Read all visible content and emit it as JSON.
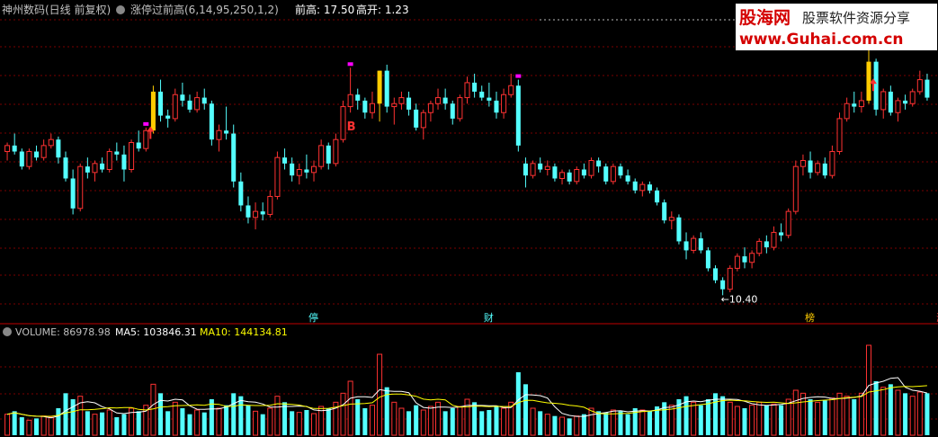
{
  "header": {
    "title": "神州数码(日线 前复权)",
    "indicator": "涨停过前高(6,14,95,250,1,2)",
    "prev_high_label": "前高: 17.50",
    "gap_label": "高开: 1.23"
  },
  "watermark": {
    "brand": "股海网",
    "slogan": "股票软件资源分享",
    "url": "www.Guhai.com.cn"
  },
  "annotations": {
    "buy": "B",
    "low": "←10.40",
    "tags": [
      "停",
      "财",
      "榜",
      "涨"
    ]
  },
  "volume_header": {
    "volume": "VOLUME: 86978.98",
    "ma5": "MA5: 103846.31",
    "ma10": "MA10: 144134.81"
  },
  "colors": {
    "up": "#ff3232",
    "down": "#54ffff",
    "limit_up": "#ffcc00",
    "marker": "#ff00ff",
    "ma5": "#ffffff",
    "ma10": "#ffff00",
    "grid": "#7a0000"
  },
  "chart_data": {
    "type": "candlestick",
    "low_value": 10.4,
    "prev_high": 17.5,
    "candles": [
      [
        15.2,
        15.5,
        14.9,
        15.4
      ],
      [
        15.4,
        15.8,
        15.1,
        15.2
      ],
      [
        15.2,
        15.3,
        14.6,
        14.7
      ],
      [
        14.7,
        15.3,
        14.6,
        15.2
      ],
      [
        15.2,
        15.4,
        14.9,
        15.0
      ],
      [
        15.0,
        15.6,
        14.9,
        15.4
      ],
      [
        15.4,
        15.8,
        15.3,
        15.6
      ],
      [
        15.6,
        15.7,
        14.8,
        15.0
      ],
      [
        15.0,
        15.2,
        14.2,
        14.3
      ],
      [
        14.3,
        14.6,
        13.1,
        13.3
      ],
      [
        13.3,
        14.8,
        13.2,
        14.7
      ],
      [
        14.7,
        15.0,
        14.3,
        14.5
      ],
      [
        14.5,
        14.9,
        14.2,
        14.8
      ],
      [
        14.8,
        15.0,
        14.5,
        14.6
      ],
      [
        14.6,
        15.3,
        14.5,
        15.2
      ],
      [
        15.2,
        15.5,
        14.9,
        15.1
      ],
      [
        15.1,
        15.4,
        14.2,
        14.6
      ],
      [
        14.6,
        15.6,
        14.5,
        15.5
      ],
      [
        15.5,
        15.9,
        15.2,
        15.3
      ],
      [
        15.3,
        16.0,
        15.2,
        15.9
      ],
      [
        15.9,
        17.4,
        15.8,
        17.2
      ],
      [
        17.2,
        17.6,
        16.2,
        16.4
      ],
      [
        16.4,
        16.6,
        16.0,
        16.3
      ],
      [
        16.3,
        17.3,
        16.2,
        17.1
      ],
      [
        17.1,
        17.5,
        16.7,
        16.9
      ],
      [
        16.9,
        17.1,
        16.5,
        16.6
      ],
      [
        16.6,
        17.2,
        16.5,
        17.0
      ],
      [
        17.0,
        17.3,
        16.6,
        16.8
      ],
      [
        16.8,
        16.9,
        15.4,
        15.6
      ],
      [
        15.6,
        16.1,
        15.2,
        15.9
      ],
      [
        15.9,
        16.7,
        15.6,
        15.8
      ],
      [
        15.8,
        16.1,
        14.0,
        14.2
      ],
      [
        14.2,
        14.5,
        13.2,
        13.4
      ],
      [
        13.4,
        13.7,
        12.8,
        13.0
      ],
      [
        13.0,
        13.5,
        12.6,
        13.2
      ],
      [
        13.2,
        13.5,
        12.9,
        13.1
      ],
      [
        13.1,
        13.9,
        13.0,
        13.7
      ],
      [
        13.7,
        15.2,
        13.6,
        15.0
      ],
      [
        15.0,
        15.3,
        14.6,
        14.8
      ],
      [
        14.8,
        15.0,
        14.2,
        14.4
      ],
      [
        14.4,
        14.8,
        14.1,
        14.6
      ],
      [
        14.6,
        15.1,
        14.3,
        14.5
      ],
      [
        14.5,
        14.9,
        14.2,
        14.7
      ],
      [
        14.7,
        15.6,
        14.6,
        15.4
      ],
      [
        15.4,
        15.5,
        14.6,
        14.8
      ],
      [
        14.8,
        15.8,
        14.7,
        15.6
      ],
      [
        15.6,
        16.9,
        15.5,
        16.7
      ],
      [
        16.7,
        18.0,
        16.5,
        17.1
      ],
      [
        17.1,
        17.3,
        16.6,
        16.9
      ],
      [
        16.9,
        17.0,
        16.3,
        16.5
      ],
      [
        16.5,
        17.2,
        16.3,
        16.8
      ],
      [
        16.8,
        17.9,
        16.2,
        17.9
      ],
      [
        17.9,
        18.1,
        16.5,
        16.7
      ],
      [
        16.7,
        17.0,
        16.1,
        16.8
      ],
      [
        16.8,
        17.2,
        16.6,
        17.0
      ],
      [
        17.0,
        17.2,
        16.4,
        16.6
      ],
      [
        16.6,
        16.8,
        15.9,
        16.0
      ],
      [
        16.0,
        16.6,
        15.6,
        16.5
      ],
      [
        16.5,
        16.9,
        16.2,
        16.8
      ],
      [
        16.8,
        17.3,
        16.6,
        17.0
      ],
      [
        17.0,
        17.3,
        16.6,
        16.8
      ],
      [
        16.8,
        16.9,
        16.1,
        16.3
      ],
      [
        16.3,
        17.1,
        16.2,
        17.0
      ],
      [
        17.0,
        17.7,
        16.8,
        17.5
      ],
      [
        17.5,
        17.8,
        17.0,
        17.2
      ],
      [
        17.2,
        17.4,
        16.9,
        17.0
      ],
      [
        17.0,
        17.5,
        16.7,
        16.9
      ],
      [
        16.9,
        17.2,
        16.3,
        16.5
      ],
      [
        16.5,
        17.3,
        16.3,
        17.1
      ],
      [
        17.1,
        17.8,
        17.0,
        17.4
      ],
      [
        17.4,
        17.6,
        15.2,
        15.4
      ],
      [
        14.8,
        15.0,
        14.0,
        14.4
      ],
      [
        14.4,
        14.9,
        14.3,
        14.8
      ],
      [
        14.8,
        15.0,
        14.5,
        14.6
      ],
      [
        14.6,
        14.9,
        14.4,
        14.7
      ],
      [
        14.7,
        14.8,
        14.2,
        14.3
      ],
      [
        14.3,
        14.6,
        14.1,
        14.5
      ],
      [
        14.5,
        14.6,
        14.1,
        14.2
      ],
      [
        14.2,
        14.7,
        14.1,
        14.6
      ],
      [
        14.6,
        14.8,
        14.3,
        14.4
      ],
      [
        14.4,
        15.0,
        14.3,
        14.9
      ],
      [
        14.9,
        15.0,
        14.5,
        14.7
      ],
      [
        14.7,
        14.8,
        14.1,
        14.2
      ],
      [
        14.2,
        14.8,
        14.1,
        14.7
      ],
      [
        14.7,
        14.8,
        14.3,
        14.4
      ],
      [
        14.4,
        14.6,
        14.1,
        14.2
      ],
      [
        14.2,
        14.3,
        13.8,
        13.9
      ],
      [
        13.9,
        14.2,
        13.7,
        14.1
      ],
      [
        14.1,
        14.2,
        13.8,
        13.9
      ],
      [
        13.9,
        14.0,
        13.4,
        13.5
      ],
      [
        13.5,
        13.6,
        12.8,
        12.9
      ],
      [
        12.9,
        13.2,
        12.6,
        13.0
      ],
      [
        13.0,
        13.1,
        12.1,
        12.2
      ],
      [
        12.2,
        12.5,
        11.6,
        11.9
      ],
      [
        11.9,
        12.4,
        11.8,
        12.3
      ],
      [
        12.3,
        12.5,
        11.8,
        11.9
      ],
      [
        11.9,
        12.0,
        11.2,
        11.3
      ],
      [
        11.3,
        11.4,
        10.8,
        10.9
      ],
      [
        10.9,
        11.0,
        10.4,
        10.6
      ],
      [
        10.6,
        11.4,
        10.5,
        11.3
      ],
      [
        11.3,
        11.8,
        11.2,
        11.7
      ],
      [
        11.7,
        12.0,
        11.3,
        11.5
      ],
      [
        11.5,
        11.9,
        11.3,
        11.8
      ],
      [
        11.8,
        12.3,
        11.7,
        12.2
      ],
      [
        12.2,
        12.4,
        11.8,
        12.0
      ],
      [
        12.0,
        12.7,
        11.9,
        12.5
      ],
      [
        12.5,
        12.8,
        12.2,
        12.4
      ],
      [
        12.4,
        13.3,
        12.3,
        13.2
      ],
      [
        13.2,
        14.9,
        13.1,
        14.7
      ],
      [
        14.7,
        15.1,
        14.4,
        14.9
      ],
      [
        14.9,
        15.2,
        14.3,
        14.5
      ],
      [
        14.5,
        14.9,
        14.4,
        14.8
      ],
      [
        14.8,
        15.0,
        14.3,
        14.4
      ],
      [
        14.4,
        15.4,
        14.3,
        15.2
      ],
      [
        15.2,
        16.5,
        15.1,
        16.3
      ],
      [
        16.3,
        17.0,
        16.2,
        16.8
      ],
      [
        16.8,
        17.2,
        16.5,
        16.7
      ],
      [
        16.7,
        17.2,
        16.5,
        16.9
      ],
      [
        16.9,
        19.2,
        16.8,
        18.2
      ],
      [
        18.2,
        18.3,
        16.4,
        16.6
      ],
      [
        16.6,
        17.3,
        16.3,
        17.2
      ],
      [
        17.2,
        17.4,
        16.4,
        16.5
      ],
      [
        16.5,
        17.0,
        16.2,
        16.9
      ],
      [
        16.9,
        17.1,
        16.6,
        16.8
      ],
      [
        16.8,
        17.3,
        16.7,
        17.2
      ],
      [
        17.2,
        17.9,
        17.1,
        17.6
      ],
      [
        17.6,
        17.8,
        16.9,
        17.0
      ]
    ],
    "volumes": [
      35,
      40,
      30,
      25,
      28,
      32,
      30,
      45,
      70,
      60,
      65,
      40,
      35,
      38,
      42,
      30,
      35,
      45,
      40,
      50,
      85,
      70,
      40,
      55,
      45,
      35,
      42,
      38,
      60,
      45,
      50,
      70,
      65,
      50,
      40,
      35,
      45,
      65,
      55,
      40,
      38,
      42,
      36,
      48,
      45,
      55,
      70,
      90,
      60,
      45,
      50,
      135,
      80,
      55,
      45,
      40,
      50,
      42,
      48,
      55,
      40,
      45,
      48,
      60,
      55,
      40,
      42,
      48,
      45,
      55,
      105,
      85,
      45,
      40,
      35,
      32,
      30,
      28,
      32,
      35,
      45,
      40,
      38,
      42,
      40,
      35,
      45,
      42,
      40,
      48,
      55,
      50,
      60,
      65,
      55,
      50,
      60,
      70,
      65,
      55,
      48,
      45,
      50,
      55,
      50,
      52,
      50,
      60,
      75,
      70,
      60,
      55,
      58,
      62,
      70,
      65,
      60,
      70,
      150,
      90,
      80,
      85,
      75,
      70,
      65,
      72,
      70
    ],
    "marker_indices": [
      19,
      47,
      70,
      118
    ],
    "buy_index": 47,
    "low_index": 98,
    "limit_up_indices": [
      20,
      51,
      118
    ],
    "tag_indices": [
      42,
      66,
      110,
      128
    ]
  }
}
